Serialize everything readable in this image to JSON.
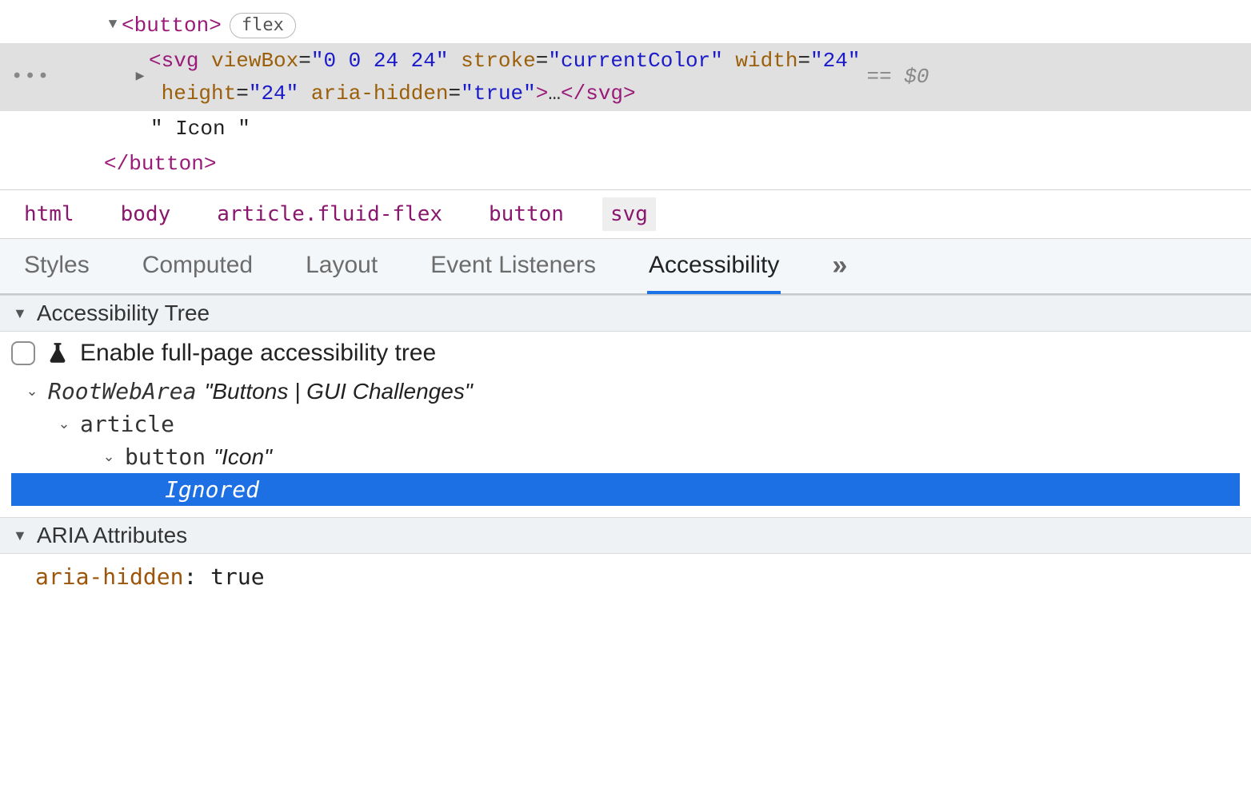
{
  "dom": {
    "button_open": "<button>",
    "flex_badge": "flex",
    "svg_tag": "svg",
    "svg_attrs": [
      {
        "n": "viewBox",
        "v": "0 0 24 24"
      },
      {
        "n": "stroke",
        "v": "currentColor"
      },
      {
        "n": "width",
        "v": "24"
      },
      {
        "n": "height",
        "v": "24"
      },
      {
        "n": "aria-hidden",
        "v": "true"
      }
    ],
    "svg_ellipsis": "…",
    "svg_close": "</svg>",
    "eq_dollar": "== $0",
    "text_node": "\" Icon \"",
    "button_close": "</button>"
  },
  "breadcrumbs": [
    "html",
    "body",
    "article.fluid-flex",
    "button",
    "svg"
  ],
  "tabs": [
    "Styles",
    "Computed",
    "Layout",
    "Event Listeners",
    "Accessibility"
  ],
  "a11y": {
    "section1": "Accessibility Tree",
    "enable_label": "Enable full-page accessibility tree",
    "tree": {
      "root_role": "RootWebArea",
      "root_name": "\"Buttons | GUI Challenges\"",
      "article_role": "article",
      "button_role": "button",
      "button_name": "\"Icon\"",
      "ignored": "Ignored"
    },
    "section2": "ARIA Attributes",
    "aria_attr_key": "aria-hidden",
    "aria_attr_val": "true"
  }
}
